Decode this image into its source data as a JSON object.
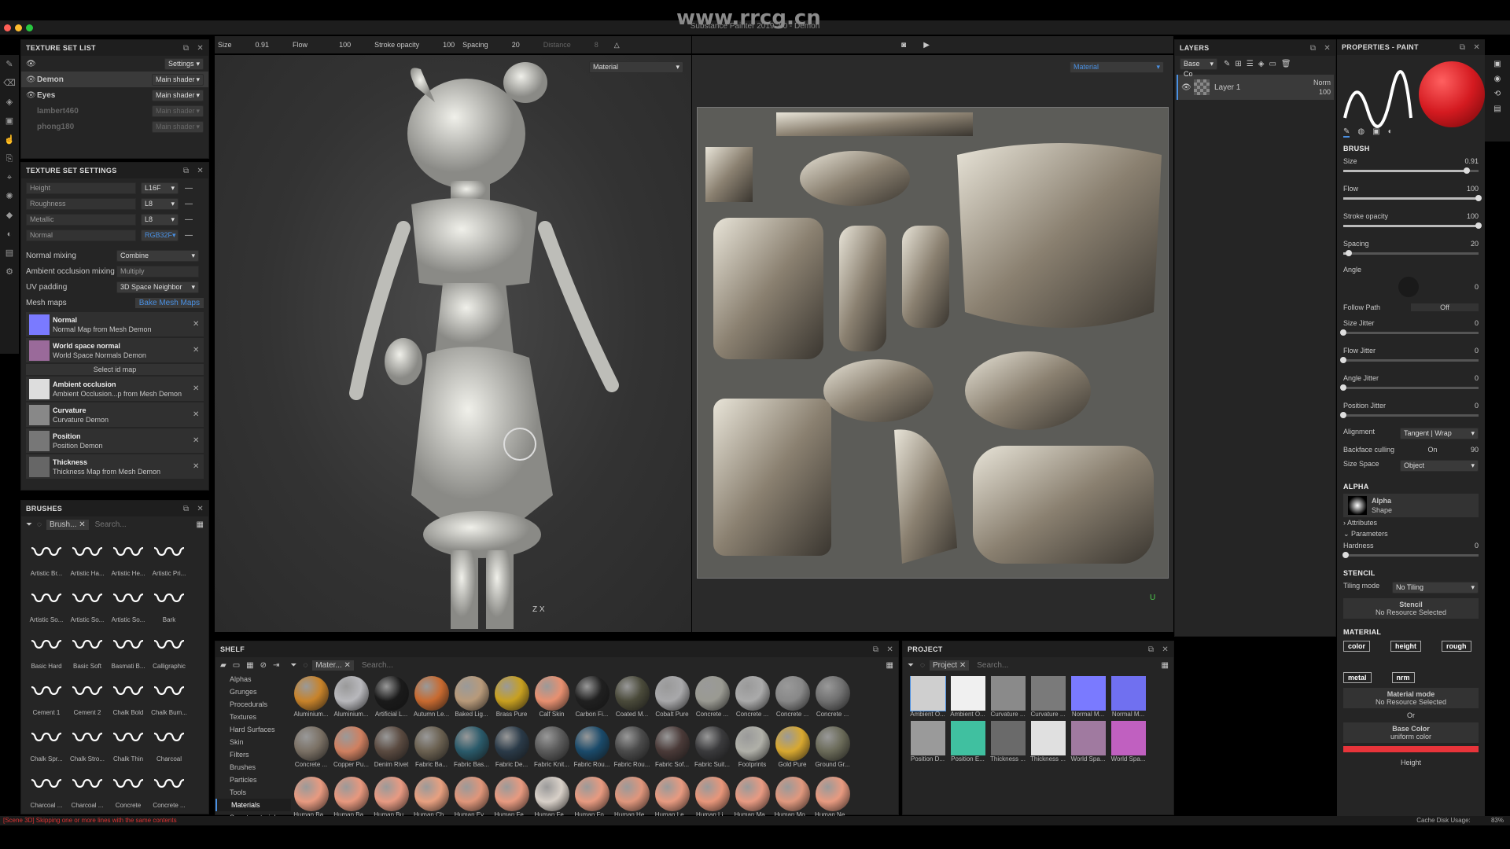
{
  "watermark_top": "www.rrcg.cn",
  "app": {
    "title": "Substance Painter 2019.2.0 - Demon"
  },
  "toolbar": {
    "size_label": "Size",
    "size_value": "0.91",
    "flow_label": "Flow",
    "flow_value": "100",
    "stroke_label": "Stroke opacity",
    "stroke_value": "100",
    "spacing_label": "Spacing",
    "spacing_value": "20",
    "distance_label": "Distance",
    "distance_value": "8"
  },
  "viewport": {
    "left_mode": "Material",
    "right_mode": "Material",
    "axis_label_3d": "Z X",
    "axis_label_2d": "U"
  },
  "texture_set_list": {
    "title": "TEXTURE SET LIST",
    "settings_label": "Settings",
    "items": [
      {
        "name": "Demon",
        "shader": "Main shader",
        "active": true
      },
      {
        "name": "Eyes",
        "shader": "Main shader",
        "active": false
      },
      {
        "name": "lambert460",
        "shader": "Main shader",
        "active": false
      },
      {
        "name": "phong180",
        "shader": "Main shader",
        "active": false
      }
    ]
  },
  "texture_set_settings": {
    "title": "TEXTURE SET SETTINGS",
    "channels": [
      {
        "name": "Height",
        "format": "L16F"
      },
      {
        "name": "Roughness",
        "format": "L8"
      },
      {
        "name": "Metallic",
        "format": "L8"
      },
      {
        "name": "Normal",
        "format": "RGB32F"
      }
    ],
    "normal_mixing_label": "Normal mixing",
    "normal_mixing_value": "Combine",
    "ao_mixing_label": "Ambient occlusion mixing",
    "ao_mixing_value": "Multiply",
    "uv_padding_label": "UV padding",
    "uv_padding_value": "3D Space Neighbor",
    "mesh_maps_label": "Mesh maps",
    "bake_label": "Bake Mesh Maps",
    "select_id_label": "Select id map",
    "maps": [
      {
        "name": "Normal",
        "source": "Normal Map from Mesh Demon",
        "color": "#7a7aff"
      },
      {
        "name": "World space normal",
        "source": "World Space Normals Demon",
        "color": "#9a6a9a"
      },
      {
        "name": "Ambient occlusion",
        "source": "Ambient Occlusion...p from Mesh Demon",
        "color": "#ddd"
      },
      {
        "name": "Curvature",
        "source": "Curvature Demon",
        "color": "#888"
      },
      {
        "name": "Position",
        "source": "Position Demon",
        "color": "#777"
      },
      {
        "name": "Thickness",
        "source": "Thickness Map from Mesh Demon",
        "color": "#666"
      }
    ]
  },
  "brushes": {
    "title": "BRUSHES",
    "filter_tag": "Brush...",
    "search_placeholder": "Search...",
    "items": [
      "Artistic Br...",
      "Artistic Ha...",
      "Artistic He...",
      "Artistic Pri...",
      "Artistic So...",
      "Artistic So...",
      "Artistic So...",
      "Bark",
      "Basic Hard",
      "Basic Soft",
      "Basmati B...",
      "Calligraphic",
      "Cement 1",
      "Cement 2",
      "Chalk Bold",
      "Chalk Bum...",
      "Chalk Spr...",
      "Chalk Stro...",
      "Chalk Thin",
      "Charcoal",
      "Charcoal ...",
      "Charcoal ...",
      "Concrete",
      "Concrete ..."
    ]
  },
  "shelf": {
    "title": "SHELF",
    "filter_tag": "Mater...",
    "search_placeholder": "Search...",
    "categories": [
      "Alphas",
      "Grunges",
      "Procedurals",
      "Textures",
      "Hard Surfaces",
      "Skin",
      "Filters",
      "Brushes",
      "Particles",
      "Tools",
      "Materials",
      "Smart materials"
    ],
    "active_category": "Materials",
    "materials": [
      {
        "name": "Aluminium...",
        "color": "#c8832a"
      },
      {
        "name": "Aluminium...",
        "color": "#b8b8bc"
      },
      {
        "name": "Artificial L...",
        "color": "#1a1a1a"
      },
      {
        "name": "Autumn Le...",
        "color": "#c86a30"
      },
      {
        "name": "Baked Lig...",
        "color": "#b89a7a"
      },
      {
        "name": "Brass Pure",
        "color": "#c8a020"
      },
      {
        "name": "Calf Skin",
        "color": "#e89070"
      },
      {
        "name": "Carbon Fi...",
        "color": "#202020"
      },
      {
        "name": "Coated M...",
        "color": "#4a4a3a"
      },
      {
        "name": "Cobalt Pure",
        "color": "#a8a8aa"
      },
      {
        "name": "Concrete ...",
        "color": "#9a9a92"
      },
      {
        "name": "Concrete ...",
        "color": "#aaaaaa"
      },
      {
        "name": "Concrete ...",
        "color": "#888888"
      },
      {
        "name": "Concrete ...",
        "color": "#707070"
      },
      {
        "name": "Concrete ...",
        "color": "#7a7064"
      },
      {
        "name": "Copper Pu...",
        "color": "#d08060"
      },
      {
        "name": "Denim Rivet",
        "color": "#5a4a40"
      },
      {
        "name": "Fabric Ba...",
        "color": "#6a6050"
      },
      {
        "name": "Fabric Bas...",
        "color": "#2a5a6a"
      },
      {
        "name": "Fabric De...",
        "color": "#2a3a48"
      },
      {
        "name": "Fabric Knit...",
        "color": "#5a5a5a"
      },
      {
        "name": "Fabric Rou...",
        "color": "#1a4a6a"
      },
      {
        "name": "Fabric Rou...",
        "color": "#4a4a4a"
      },
      {
        "name": "Fabric Sof...",
        "color": "#4a3a38"
      },
      {
        "name": "Fabric Suit...",
        "color": "#3a3a3c"
      },
      {
        "name": "Footprints",
        "color": "#b0b0a8"
      },
      {
        "name": "Gold Pure",
        "color": "#d8a830"
      },
      {
        "name": "Ground Gr...",
        "color": "#6a6a58"
      },
      {
        "name": "Human Ba...",
        "color": "#e89a80"
      },
      {
        "name": "Human Ba...",
        "color": "#e8987e"
      },
      {
        "name": "Human Bu...",
        "color": "#e89a82"
      },
      {
        "name": "Human Ch...",
        "color": "#e8a080"
      },
      {
        "name": "Human Ey...",
        "color": "#e0967a"
      },
      {
        "name": "Human Fe...",
        "color": "#e89a80"
      },
      {
        "name": "Human Fe...",
        "color": "#d8d0c8"
      },
      {
        "name": "Human Fo...",
        "color": "#e89a80"
      },
      {
        "name": "Human He...",
        "color": "#e0967c"
      },
      {
        "name": "Human Le...",
        "color": "#e89a80"
      },
      {
        "name": "Human Li...",
        "color": "#e8967a"
      },
      {
        "name": "Human Ma...",
        "color": "#e89a82"
      },
      {
        "name": "Human Mo...",
        "color": "#e0987e"
      },
      {
        "name": "Human Ne...",
        "color": "#e89a80"
      }
    ]
  },
  "project": {
    "title": "PROJECT",
    "filter_tag": "Project",
    "search_placeholder": "Search...",
    "items": [
      {
        "name": "Ambient O...",
        "color": "#cfcfcf"
      },
      {
        "name": "Ambient O...",
        "color": "#f0f0f0"
      },
      {
        "name": "Curvature ...",
        "color": "#8a8a8a"
      },
      {
        "name": "Curvature ...",
        "color": "#7a7a7a"
      },
      {
        "name": "Normal M...",
        "color": "#7a7aff"
      },
      {
        "name": "Normal M...",
        "color": "#7070f0"
      },
      {
        "name": "Position D...",
        "color": "#9a9a9a"
      },
      {
        "name": "Position E...",
        "color": "#40c0a0"
      },
      {
        "name": "Thickness ...",
        "color": "#6a6a6a"
      },
      {
        "name": "Thickness ...",
        "color": "#e0e0e0"
      },
      {
        "name": "World Spa...",
        "color": "#a07aa0"
      },
      {
        "name": "World Spa...",
        "color": "#c060c0"
      }
    ]
  },
  "layers": {
    "title": "LAYERS",
    "channel": "Base Co",
    "items": [
      {
        "name": "Layer 1",
        "blend": "Norm",
        "opacity": "100"
      }
    ]
  },
  "properties": {
    "title": "PROPERTIES - PAINT",
    "brush_section": "BRUSH",
    "size_label": "Size",
    "size_value": "0.91",
    "size_level": 0.91,
    "flow_label": "Flow",
    "flow_value": "100",
    "flow_level": 1.0,
    "stroke_label": "Stroke opacity",
    "stroke_value": "100",
    "stroke_level": 1.0,
    "spacing_label": "Spacing",
    "spacing_value": "20",
    "spacing_level": 0.04,
    "angle_label": "Angle",
    "angle_value": "0",
    "follow_path_label": "Follow Path",
    "follow_path_value": "Off",
    "size_jitter_label": "Size Jitter",
    "size_jitter_value": "0",
    "flow_jitter_label": "Flow Jitter",
    "flow_jitter_value": "0",
    "angle_jitter_label": "Angle Jitter",
    "angle_jitter_value": "0",
    "position_jitter_label": "Position Jitter",
    "position_jitter_value": "0",
    "alignment_label": "Alignment",
    "alignment_value": "Tangent | Wrap",
    "backface_label": "Backface culling",
    "backface_state": "On",
    "backface_value": "90",
    "size_space_label": "Size Space",
    "size_space_value": "Object",
    "alpha_section": "ALPHA",
    "alpha_name": "Alpha",
    "alpha_sub": "Shape",
    "attributes_label": "Attributes",
    "parameters_label": "Parameters",
    "hardness_label": "Hardness",
    "hardness_value": "0",
    "stencil_section": "STENCIL",
    "tiling_label": "Tiling mode",
    "tiling_value": "No Tiling",
    "stencil_title": "Stencil",
    "stencil_sub": "No Resource Selected",
    "material_section": "MATERIAL",
    "chips": [
      "color",
      "height",
      "rough",
      "metal",
      "nrm"
    ],
    "material_mode_title": "Material mode",
    "material_mode_sub": "No Resource Selected",
    "or_label": "Or",
    "base_color_title": "Base Color",
    "base_color_sub": "uniform color",
    "base_color": "#e8343a",
    "height_label": "Height"
  },
  "status": {
    "message": "[Scene 3D] Skipping one or more lines with the same contents",
    "disk_label": "Cache Disk Usage:",
    "disk_value": "83%"
  }
}
